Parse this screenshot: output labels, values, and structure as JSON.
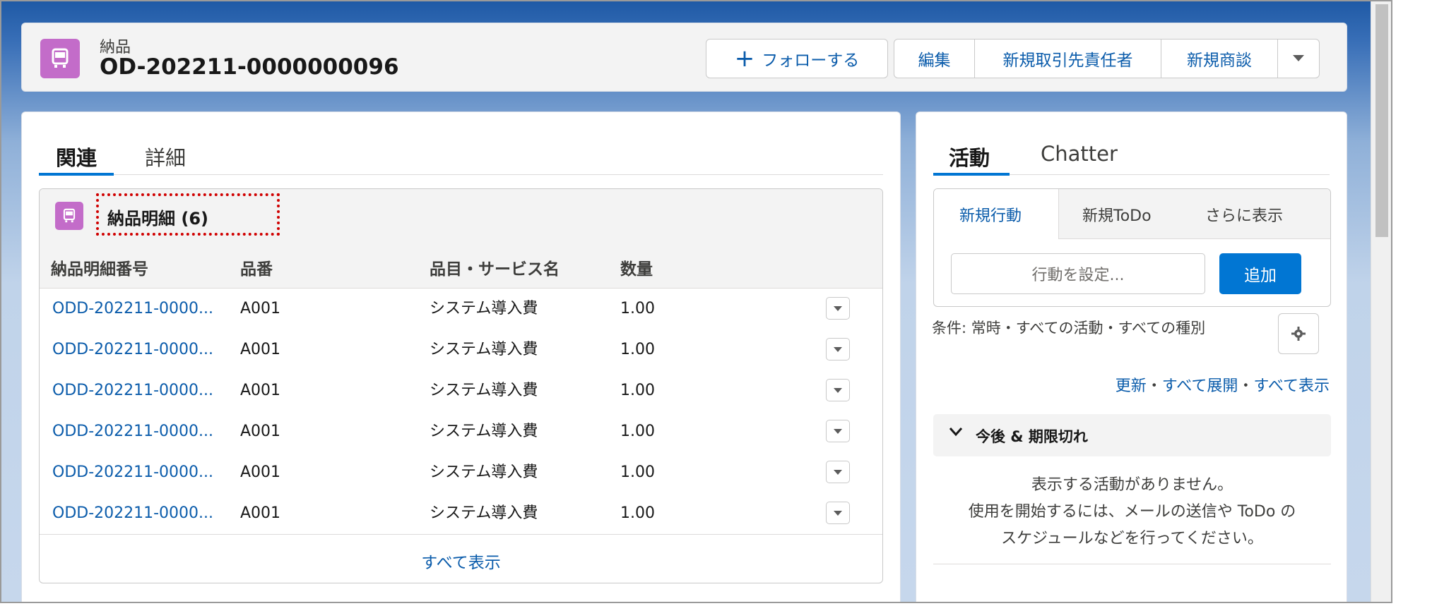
{
  "record": {
    "object_label": "納品",
    "title": "OD-202211-0000000096",
    "icon": "truck-icon"
  },
  "actions": {
    "follow": "フォローする",
    "edit": "編集",
    "new_contact": "新規取引先責任者",
    "new_opportunity": "新規商談"
  },
  "left_tabs": {
    "related": "関連",
    "details": "詳細"
  },
  "related_list": {
    "title": "納品明細 (6)",
    "columns": [
      "納品明細番号",
      "品番",
      "品目・サービス名",
      "数量"
    ],
    "rows": [
      [
        "ODD-202211-0000...",
        "A001",
        "システム導入費",
        "1.00"
      ],
      [
        "ODD-202211-0000...",
        "A001",
        "システム導入費",
        "1.00"
      ],
      [
        "ODD-202211-0000...",
        "A001",
        "システム導入費",
        "1.00"
      ],
      [
        "ODD-202211-0000...",
        "A001",
        "システム導入費",
        "1.00"
      ],
      [
        "ODD-202211-0000...",
        "A001",
        "システム導入費",
        "1.00"
      ],
      [
        "ODD-202211-0000...",
        "A001",
        "システム導入費",
        "1.00"
      ]
    ],
    "view_all": "すべて表示"
  },
  "right_tabs": {
    "activity": "活動",
    "chatter": "Chatter"
  },
  "activity": {
    "tabs": [
      "新規行動",
      "新規ToDo",
      "さらに表示"
    ],
    "input_placeholder": "行動を設定...",
    "add_button": "追加",
    "filter_text": "条件: 常時・すべての活動・すべての種別",
    "link_refresh": "更新",
    "link_expand_all": "すべて展開",
    "link_view_all": "すべて表示",
    "separator": "・",
    "section_title": "今後 & 期限切れ",
    "empty_line1": "表示する活動がありません。",
    "empty_line2": "使用を開始するには、メールの送信や ToDo の",
    "empty_line3": "スケジュールなどを行ってください。"
  },
  "colors": {
    "brand_blue": "#0176d3",
    "link_blue": "#0b5cab",
    "object_icon": "#c36cc9",
    "highlight_red": "#d00000"
  }
}
